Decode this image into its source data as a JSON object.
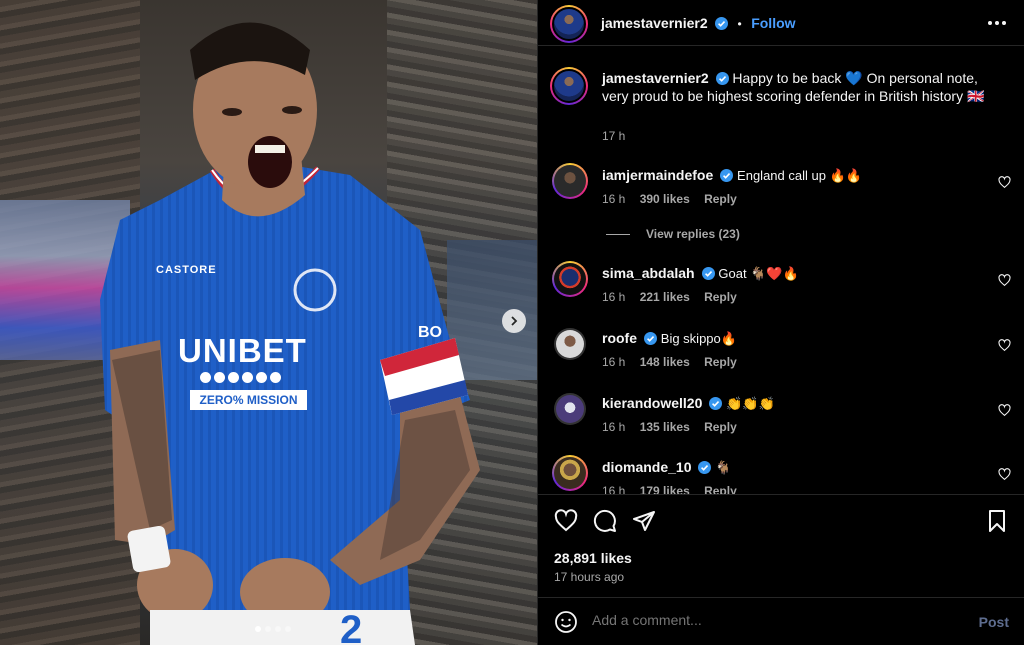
{
  "post": {
    "username": "jamestavernier2",
    "separator": "•",
    "follow_label": "Follow",
    "caption": "Happy to be back 💙 On personal note, very proud to be highest scoring defender in British history 🇬🇧",
    "caption_time": "17 h",
    "shirt_sponsor": "UNIBET",
    "shirt_sub": "ZERO% MISSION",
    "shirt_brand": "CASTORE",
    "shirt_number": "2",
    "armband_text": "BO"
  },
  "comments": [
    {
      "user": "iamjermaindefoe",
      "text": "England call up 🔥🔥",
      "time": "16 h",
      "likes": "390 likes",
      "reply": "Reply"
    },
    {
      "user": "sima_abdalah",
      "text": "Goat 🐐❤️🔥",
      "time": "16 h",
      "likes": "221 likes",
      "reply": "Reply"
    },
    {
      "user": "roofe",
      "text": "Big skippo🔥",
      "time": "16 h",
      "likes": "148 likes",
      "reply": "Reply"
    },
    {
      "user": "kierandowell20",
      "text": "👏👏👏",
      "time": "16 h",
      "likes": "135 likes",
      "reply": "Reply"
    },
    {
      "user": "diomande_10",
      "text": "🐐",
      "time": "16 h",
      "likes": "179 likes",
      "reply": "Reply"
    }
  ],
  "view_replies": "View replies (23)",
  "stats": {
    "likes": "28,891 likes",
    "posted": "17 hours ago"
  },
  "add_comment": {
    "placeholder": "Add a comment...",
    "post_label": "Post"
  },
  "carousel": {
    "count": 4,
    "active_index": 0
  },
  "icons": {
    "verified": "verified-badge-icon",
    "like": "heart-icon",
    "comment": "comment-icon",
    "share": "share-icon",
    "save": "bookmark-icon",
    "more": "more-dots-icon",
    "emoji": "emoji-icon",
    "next": "chevron-right-icon"
  },
  "colors": {
    "accent_blue": "#4a9eff",
    "verified_blue": "#3797f0",
    "jersey_blue": "#1f5fc7",
    "background": "#000000"
  }
}
